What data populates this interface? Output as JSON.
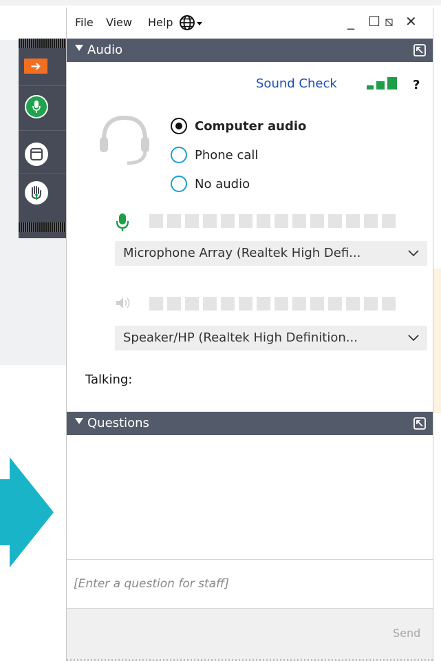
{
  "menu": {
    "file": "File",
    "view": "View",
    "help": "Help"
  },
  "window_controls": [
    "_",
    "☐",
    "⧅",
    "✕"
  ],
  "icons": {
    "language": "globe-icon",
    "minimize": "minimize-icon",
    "maximize": "maximize-icon",
    "restore": "restore-icon",
    "close": "close-icon",
    "popout": "popout-icon",
    "headset": "headset-icon",
    "microphone": "microphone-icon",
    "speaker": "speaker-icon",
    "toolbar": [
      "arrow-right-icon",
      "microphone-icon",
      "window-icon",
      "raise-hand-icon"
    ]
  },
  "audio": {
    "header": "Audio",
    "sound_check": "Sound Check",
    "help": "?",
    "options": [
      {
        "label": "Computer audio",
        "selected": true
      },
      {
        "label": "Phone call",
        "selected": false
      },
      {
        "label": "No audio",
        "selected": false
      }
    ],
    "microphone_device": "Microphone Array (Realtek High Defi...",
    "speaker_device": "Speaker/HP (Realtek High Definition...",
    "talking_label": "Talking:"
  },
  "questions": {
    "header": "Questions",
    "placeholder": "[Enter a question for staff]",
    "send_label": "Send"
  },
  "colors": {
    "header_bg": "#535a6a",
    "accent_green": "#21a24d",
    "accent_orange": "#f26f21",
    "link_blue": "#1a4fb4",
    "arrow_teal": "#1ab4c8",
    "radio_border": "#1aa0d0"
  }
}
